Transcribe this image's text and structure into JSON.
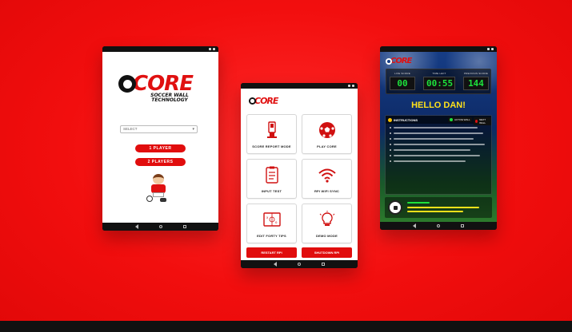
{
  "colors": {
    "brand_red": "#e10d0d",
    "background_red": "#f20e0e",
    "score_green": "#1de23c",
    "hello_yellow": "#ffe21a"
  },
  "login_screen": {
    "logo_word": "CORE",
    "logo_tagline": "SOCCER WALL TECHNOLOGY",
    "select_value": "SELECT",
    "one_player_label": "1 PLAYER",
    "two_players_label": "2 PLAYERS"
  },
  "menu_screen": {
    "logo_word": "CORE",
    "tiles": [
      {
        "label": "SCORE REPORT MODE",
        "icon": "kiosk-icon"
      },
      {
        "label": "PLAY CORE",
        "icon": "soccer-ball-icon"
      },
      {
        "label": "INPUT TEST",
        "icon": "clipboard-icon"
      },
      {
        "label": "RPI WIFI SYNC",
        "icon": "wifi-icon"
      },
      {
        "label": "EDIT FORTY TIPS",
        "icon": "tactics-board-icon"
      },
      {
        "label": "DEMO MODE",
        "icon": "lightbulb-icon"
      }
    ],
    "restart_label": "RESTART RPI",
    "shutdown_label": "SHUTDOWN RPI"
  },
  "game_screen": {
    "logo_word": "CORE",
    "live_score_caption": "LIVE SCORE",
    "live_score": "00",
    "time_left_caption": "TIME LEFT",
    "time_left": "00:55",
    "previous_score_caption": "PREVIOUS SCORE",
    "previous_score": "144",
    "greeting": "HELLO DAN!",
    "instructions_title": "INSTRUCTIONS",
    "active_wall_label": "ACTIVE WALL",
    "next_wall_label": "NEXT WALL"
  }
}
